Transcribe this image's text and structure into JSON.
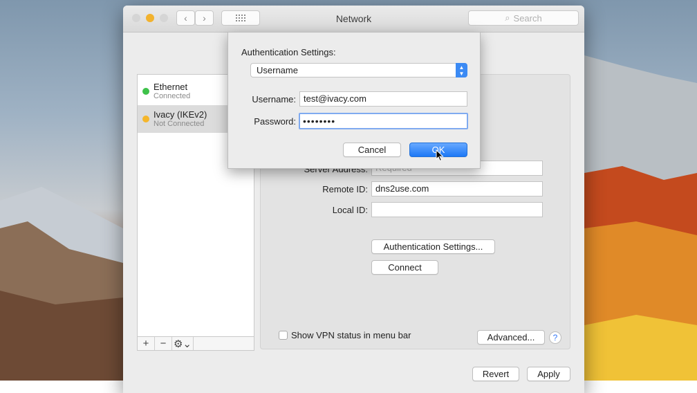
{
  "window": {
    "title": "Network",
    "search_placeholder": "Search"
  },
  "sidebar": {
    "services": [
      {
        "name": "Ethernet",
        "status": "Connected",
        "color": "#3ec24a"
      },
      {
        "name": "Ivacy (IKEv2)",
        "status": "Not Connected",
        "color": "#f5b62b"
      }
    ],
    "tools": [
      "+",
      "−",
      "⚙⌄"
    ]
  },
  "panel": {
    "server_address_label": "Server Address:",
    "server_address_placeholder": "Required",
    "remote_id_label": "Remote ID:",
    "remote_id_value": "dns2use.com",
    "local_id_label": "Local ID:",
    "local_id_value": "",
    "auth_settings_button": "Authentication Settings...",
    "connect_button": "Connect",
    "show_vpn_status_label": "Show VPN status in menu bar",
    "advanced_button": "Advanced...",
    "help_label": "?"
  },
  "footer": {
    "revert_button": "Revert",
    "apply_button": "Apply"
  },
  "auth_dialog": {
    "heading": "Authentication Settings:",
    "method_selected": "Username",
    "username_label": "Username:",
    "username_value": "test@ivacy.com",
    "password_label": "Password:",
    "password_value": "••••••••",
    "cancel_button": "Cancel",
    "ok_button": "OK"
  },
  "colors": {
    "accent": "#1d78f6",
    "close": "#d5d5d5",
    "minimize": "#f2b22e",
    "maximize": "#d5d5d5"
  }
}
